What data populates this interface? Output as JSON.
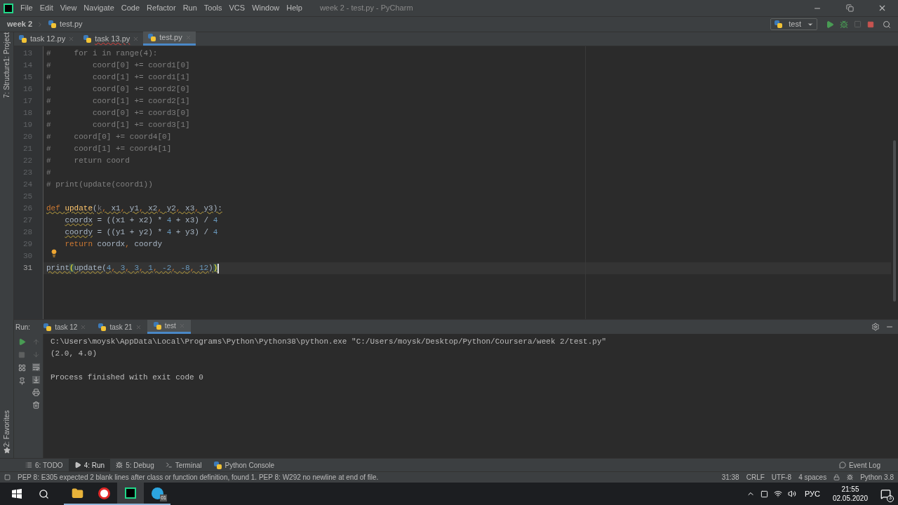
{
  "window": {
    "title": "week 2 - test.py - PyCharm",
    "menu": [
      "File",
      "Edit",
      "View",
      "Navigate",
      "Code",
      "Refactor",
      "Run",
      "Tools",
      "VCS",
      "Window",
      "Help"
    ]
  },
  "breadcrumbs": [
    "week 2",
    "test.py"
  ],
  "toolbar": {
    "run_config": "test"
  },
  "left_stripe": [
    "1: Project",
    "7: Structure"
  ],
  "left_stripe_bottom": [
    "2: Favorites"
  ],
  "tabs": [
    {
      "label": "task 12.py",
      "selected": false,
      "error": false
    },
    {
      "label": "task 13.py",
      "selected": false,
      "error": true
    },
    {
      "label": "test.py",
      "selected": true,
      "error": false
    }
  ],
  "editor": {
    "lines": [
      {
        "number": "13",
        "current": false,
        "warning": false,
        "tokens": [
          {
            "kind": "comment",
            "text": "#     for i in range(4):"
          }
        ]
      },
      {
        "number": "14",
        "current": false,
        "warning": false,
        "tokens": [
          {
            "kind": "comment",
            "text": "#         coord[0] += coord1[0]"
          }
        ]
      },
      {
        "number": "15",
        "current": false,
        "warning": false,
        "tokens": [
          {
            "kind": "comment",
            "text": "#         coord[1] += coord1[1]"
          }
        ]
      },
      {
        "number": "16",
        "current": false,
        "warning": false,
        "tokens": [
          {
            "kind": "comment",
            "text": "#         coord[0] += coord2[0]"
          }
        ]
      },
      {
        "number": "17",
        "current": false,
        "warning": false,
        "tokens": [
          {
            "kind": "comment",
            "text": "#         coord[1] += coord2[1]"
          }
        ]
      },
      {
        "number": "18",
        "current": false,
        "warning": false,
        "tokens": [
          {
            "kind": "comment",
            "text": "#         coord[0] += coord3[0]"
          }
        ]
      },
      {
        "number": "19",
        "current": false,
        "warning": false,
        "tokens": [
          {
            "kind": "comment",
            "text": "#         coord[1] += coord3[1]"
          }
        ]
      },
      {
        "number": "20",
        "current": false,
        "warning": false,
        "tokens": [
          {
            "kind": "comment",
            "text": "#     coord[0] += coord4[0]"
          }
        ]
      },
      {
        "number": "21",
        "current": false,
        "warning": false,
        "tokens": [
          {
            "kind": "comment",
            "text": "#     coord[1] += coord4[1]"
          }
        ]
      },
      {
        "number": "22",
        "current": false,
        "warning": false,
        "tokens": [
          {
            "kind": "comment",
            "text": "#     return coord"
          }
        ]
      },
      {
        "number": "23",
        "current": false,
        "warning": false,
        "tokens": [
          {
            "kind": "comment",
            "text": "#"
          }
        ]
      },
      {
        "number": "24",
        "current": false,
        "warning": false,
        "tokens": [
          {
            "kind": "comment",
            "text": "# print(update(coord1))"
          }
        ]
      },
      {
        "number": "25",
        "current": false
      },
      {
        "number": "26",
        "current": false,
        "warning": true,
        "tokens": [
          {
            "kind": "keyword",
            "text": "def "
          },
          {
            "kind": "funcdef",
            "text": "update"
          },
          {
            "kind": "plain",
            "text": "("
          },
          {
            "kind": "unused",
            "text": "k"
          },
          {
            "kind": "keyword",
            "text": ", "
          },
          {
            "kind": "plain",
            "text": "x1"
          },
          {
            "kind": "keyword",
            "text": ", "
          },
          {
            "kind": "plain",
            "text": "y1"
          },
          {
            "kind": "keyword",
            "text": ", "
          },
          {
            "kind": "plain",
            "text": "x2"
          },
          {
            "kind": "keyword",
            "text": ", "
          },
          {
            "kind": "plain",
            "text": "y2"
          },
          {
            "kind": "keyword",
            "text": ", "
          },
          {
            "kind": "plain",
            "text": "x3"
          },
          {
            "kind": "keyword",
            "text": ", "
          },
          {
            "kind": "plain",
            "text": "y3):"
          }
        ]
      },
      {
        "number": "27",
        "current": false,
        "warning": false,
        "tokens": [
          {
            "kind": "warned",
            "text": "    coordx"
          },
          {
            "kind": "plain",
            "text": " = ((x1 + x2) * "
          },
          {
            "kind": "number",
            "text": "4"
          },
          {
            "kind": "plain",
            "text": " + x3) / "
          },
          {
            "kind": "number",
            "text": "4"
          }
        ]
      },
      {
        "number": "28",
        "current": false,
        "warning": false,
        "tokens": [
          {
            "kind": "warned",
            "text": "    coordy"
          },
          {
            "kind": "plain",
            "text": " = ((y1 + y2) * "
          },
          {
            "kind": "number",
            "text": "4"
          },
          {
            "kind": "plain",
            "text": " + y3) / "
          },
          {
            "kind": "number",
            "text": "4"
          }
        ]
      },
      {
        "number": "29",
        "current": false,
        "warning": false,
        "tokens": [
          {
            "kind": "keyword",
            "text": "    return"
          },
          {
            "kind": "plain",
            "text": " coordx"
          },
          {
            "kind": "keyword",
            "text": ", "
          },
          {
            "kind": "plain",
            "text": "coordy"
          }
        ]
      },
      {
        "number": "30",
        "current": false
      },
      {
        "number": "31",
        "current": true,
        "warning": true,
        "tokens": [
          {
            "kind": "plain",
            "text": "print"
          },
          {
            "kind": "brace",
            "text": "("
          },
          {
            "kind": "plain",
            "text": "update("
          },
          {
            "kind": "number",
            "text": "4"
          },
          {
            "kind": "keyword",
            "text": ", "
          },
          {
            "kind": "number",
            "text": "3"
          },
          {
            "kind": "keyword",
            "text": ", "
          },
          {
            "kind": "number",
            "text": "3"
          },
          {
            "kind": "keyword",
            "text": ", "
          },
          {
            "kind": "number",
            "text": "1"
          },
          {
            "kind": "keyword",
            "text": ", "
          },
          {
            "kind": "number",
            "text": "-2"
          },
          {
            "kind": "keyword",
            "text": ", "
          },
          {
            "kind": "number",
            "text": "-8"
          },
          {
            "kind": "keyword",
            "text": ", "
          },
          {
            "kind": "number",
            "text": "12"
          },
          {
            "kind": "plain",
            "text": ")"
          },
          {
            "kind": "brace",
            "text": ")"
          }
        ]
      }
    ]
  },
  "run_panel": {
    "label": "Run:",
    "tabs": [
      {
        "label": "task 12",
        "selected": false
      },
      {
        "label": "task 21",
        "selected": false
      },
      {
        "label": "test",
        "selected": true
      }
    ],
    "output": [
      "C:\\Users\\moysk\\AppData\\Local\\Programs\\Python\\Python38\\python.exe \"C:/Users/moysk/Desktop/Python/Coursera/week 2/test.py\"",
      "(2.0, 4.0)"
    ],
    "exit_message": "Process finished with exit code 0"
  },
  "tool_tabs": [
    {
      "label": "6: TODO",
      "selected": false
    },
    {
      "label": "4: Run",
      "selected": true
    },
    {
      "label": "5: Debug",
      "selected": false
    },
    {
      "label": "Terminal",
      "selected": false
    },
    {
      "label": "Python Console",
      "selected": false
    }
  ],
  "event_log": "Event Log",
  "status_bar": {
    "message": "PEP 8: E305 expected 2 blank lines after class or function definition, found 1. PEP 8: W292 no newline at end of file.",
    "items": [
      "31:38",
      "CRLF",
      "UTF-8",
      "4 spaces"
    ],
    "interpreter": "Python 3.8"
  },
  "taskbar": {
    "telegram_badge": "01",
    "language": "РУС",
    "time": "21:55",
    "date": "02.05.2020",
    "notifications": "3"
  }
}
